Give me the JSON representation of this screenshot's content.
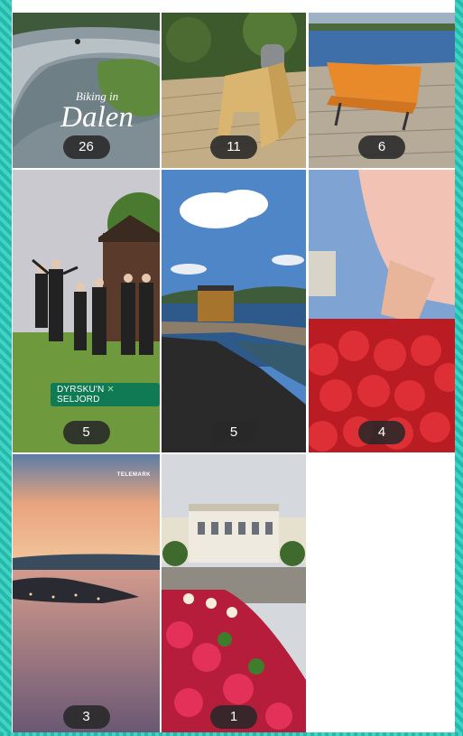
{
  "grid": {
    "tiles": [
      {
        "count": "26",
        "title_small": "Biking in",
        "title_big": "Dalen"
      },
      {
        "count": "11"
      },
      {
        "count": "6"
      },
      {
        "count": "5",
        "chip_left": "DYRSKU'N",
        "chip_right": "SELJORD"
      },
      {
        "count": "5"
      },
      {
        "count": "4"
      },
      {
        "count": "3",
        "watermark": "TELEMARK"
      },
      {
        "count": "1"
      }
    ]
  },
  "colors": {
    "frame": "#2bc4b6",
    "badge_bg": "#282828"
  }
}
